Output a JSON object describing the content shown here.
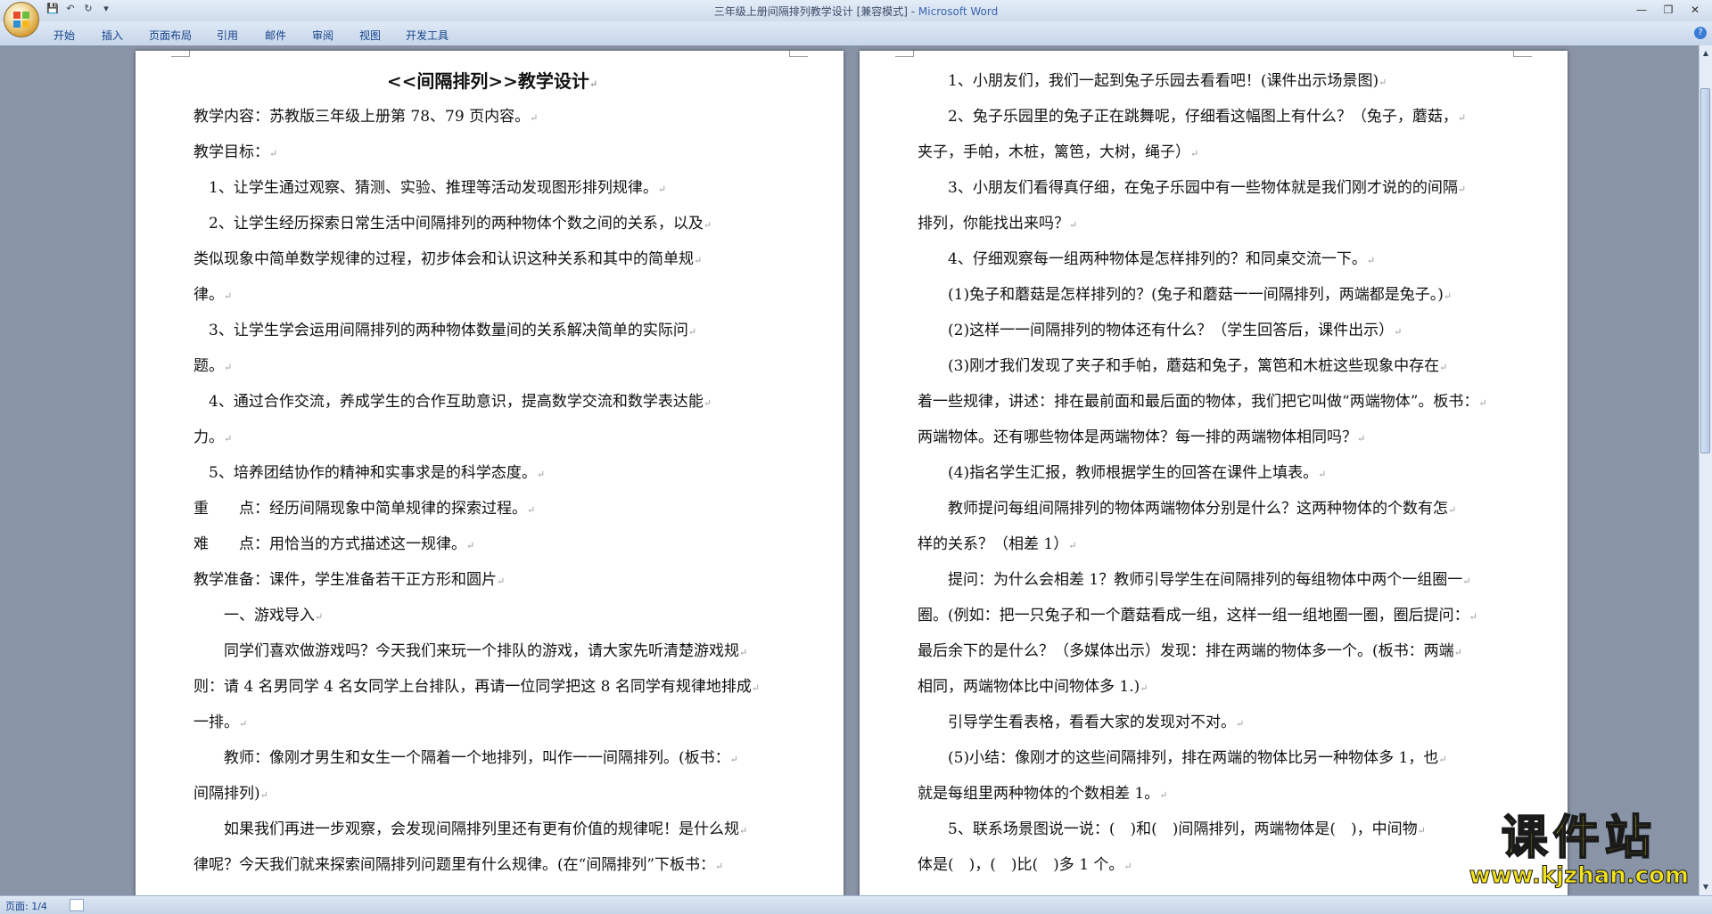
{
  "window": {
    "title": "三年级上册间隔排列教学设计 [兼容模式] - ",
    "app_name": "Microsoft Word"
  },
  "quick_access": [
    "save-icon",
    "undo-icon",
    "redo-icon",
    "customize-icon"
  ],
  "ribbon_tabs": [
    "开始",
    "插入",
    "页面布局",
    "引用",
    "邮件",
    "审阅",
    "视图",
    "开发工具"
  ],
  "page1": {
    "heading": "<<间隔排列>>教学设计",
    "lines": [
      "教学内容：苏教版三年级上册第 78、79 页内容。",
      "教学目标：",
      "　1、让学生通过观察、猜测、实验、推理等活动发现图形排列规律。",
      "　2、让学生经历探索日常生活中间隔排列的两种物体个数之间的关系，以及",
      "类似现象中简单数学规律的过程，初步体会和认识这种关系和其中的简单规",
      "律。",
      "　3、让学生学会运用间隔排列的两种物体数量间的关系解决简单的实际问",
      "题。",
      "　4、通过合作交流，养成学生的合作互助意识，提高数学交流和数学表达能",
      "力。",
      "　5、培养团结协作的精神和实事求是的科学态度。",
      "重　　点：经历间隔现象中简单规律的探索过程。",
      "难　　点：用恰当的方式描述这一规律。",
      "教学准备：课件，学生准备若干正方形和圆片",
      "　　一、游戏导入",
      "　　同学们喜欢做游戏吗？今天我们来玩一个排队的游戏，请大家先听清楚游戏规",
      "则：请 4 名男同学 4 名女同学上台排队，再请一位同学把这 8 名同学有规律地排成",
      "一排。",
      "　　教师：像刚才男生和女生一个隔着一个地排列，叫作一一间隔排列。(板书：",
      "间隔排列)",
      "　　如果我们再进一步观察，会发现间隔排列里还有更有价值的规律呢！是什么规",
      "律呢？今天我们就来探索间隔排列问题里有什么规律。(在“间隔排列”下板书："
    ]
  },
  "page2": {
    "lines": [
      "　　1、小朋友们，我们一起到兔子乐园去看看吧！(课件出示场景图)",
      "　　2、兔子乐园里的兔子正在跳舞呢，仔细看这幅图上有什么？（兔子，蘑菇，",
      "夹子，手帕，木桩，篱笆，大树，绳子）",
      "　　3、小朋友们看得真仔细，在兔子乐园中有一些物体就是我们刚才说的的间隔",
      "排列，你能找出来吗？",
      "　　4、仔细观察每一组两种物体是怎样排列的？和同桌交流一下。",
      "　　(1)兔子和蘑菇是怎样排列的？(兔子和蘑菇一一间隔排列，两端都是兔子。)",
      "　　(2)这样一一间隔排列的物体还有什么？（学生回答后，课件出示）",
      "　　(3)刚才我们发现了夹子和手帕，蘑菇和兔子，篱笆和木桩这些现象中存在",
      "着一些规律，讲述：排在最前面和最后面的物体，我们把它叫做“两端物体”。板书：",
      "两端物体。还有哪些物体是两端物体？每一排的两端物体相同吗？",
      "　　(4)指名学生汇报，教师根据学生的回答在课件上填表。",
      "　　教师提问每组间隔排列的物体两端物体分别是什么？这两种物体的个数有怎",
      "样的关系？（相差 1）",
      "　　提问：为什么会相差 1？教师引导学生在间隔排列的每组物体中两个一组圈一",
      "圈。(例如：把一只兔子和一个蘑菇看成一组，这样一组一组地圈一圈，圈后提问：",
      "最后余下的是什么？（多媒体出示）发现：排在两端的物体多一个。(板书：两端",
      "相同，两端物体比中间物体多 1.)",
      "　　引导学生看表格，看看大家的发现对不对。",
      "　　(5)小结：像刚才的这些间隔排列，排在两端的物体比另一种物体多 1，也",
      "就是每组里两种物体的个数相差 1。",
      "　　5、联系场景图说一说：(　)和(　)间隔排列，两端物体是(　)，中间物",
      "体是(　)，(　)比(　)多 1 个。"
    ]
  },
  "status": {
    "page_indicator": "页面: 1/4"
  },
  "watermark": {
    "main": "课件站",
    "url": "www.kjzhan.com"
  },
  "paragraph_mark": "↵"
}
